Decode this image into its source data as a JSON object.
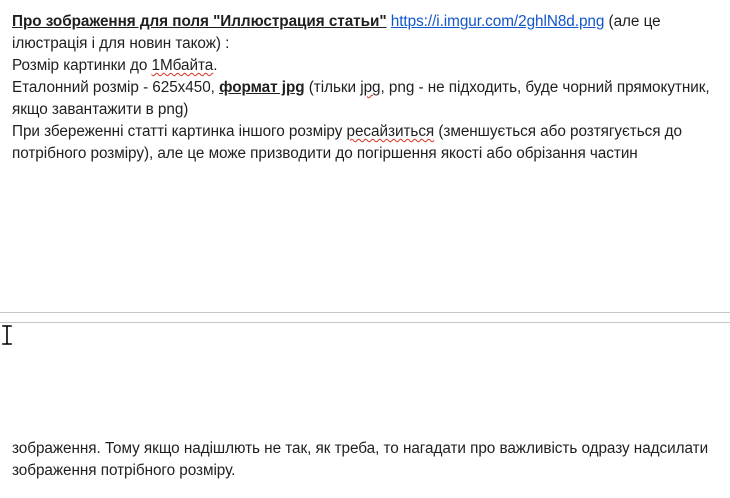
{
  "doc": {
    "heading": "Про зображення для поля \"Иллюстрация статьи\"",
    "link_text": "https://i.imgur.com/2ghlN8d.png",
    "after_link": " (але це ілюстрація і для новин також) :",
    "size_prefix": "Розмір картинки до ",
    "size_value": "1Мбайта",
    "size_suffix": ".",
    "ref_prefix": "Еталонний розмір - 625x450, ",
    "ref_format": "формат jpg",
    "ref_paren_open": " (тільки ",
    "ref_jpg": "jpg",
    "ref_rest": ", png - не підходить, буде чорний прямокутник, якщо завантажити в png)",
    "save_prefix": "При збереженні статті картинка іншого розміру ",
    "save_resize": "ресайзиться",
    "save_rest": " (зменшується або розтягується до потрібного розміру), але це може призводити до погіршення якості або обрізання частин",
    "continued": "зображення. Тому якщо надішлють не так, як треба, то нагадати про важливість одразу надсилати зображення потрібного розміру."
  },
  "icons": {
    "cursor": "text-cursor-icon"
  }
}
